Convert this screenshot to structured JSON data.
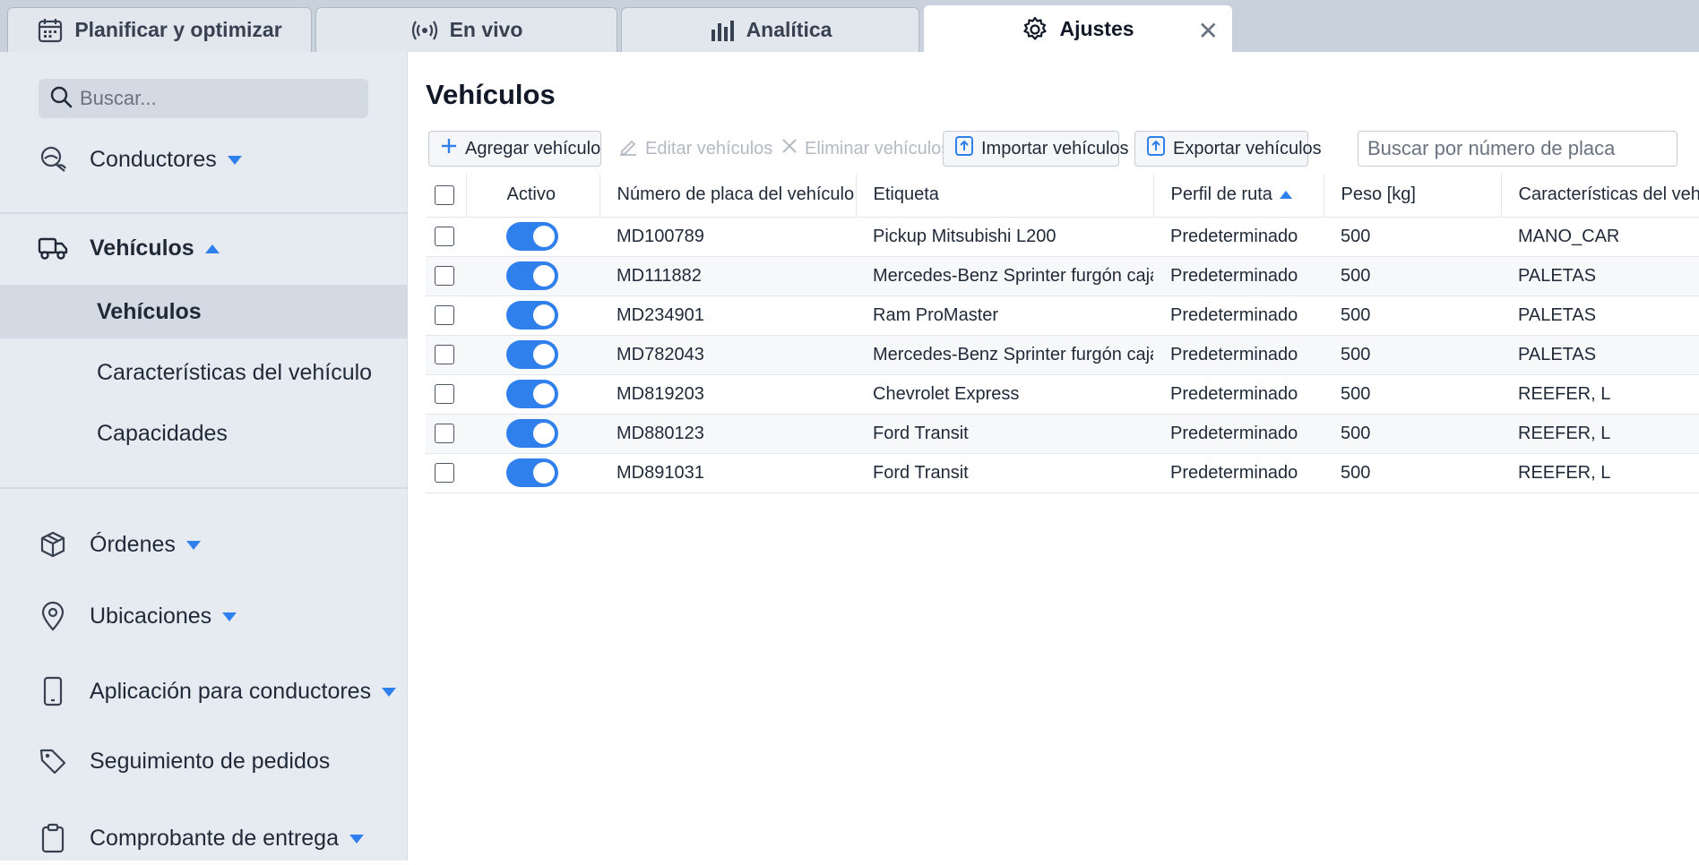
{
  "tabs": [
    {
      "label": "Planificar y optimizar",
      "icon": "calendar-icon"
    },
    {
      "label": "En vivo",
      "icon": "broadcast-icon"
    },
    {
      "label": "Analítica",
      "icon": "bar-chart-icon"
    },
    {
      "label": "Ajustes",
      "icon": "gear-icon",
      "active": true
    }
  ],
  "sidebar": {
    "search_placeholder": "Buscar...",
    "items": [
      {
        "label": "Conductores",
        "icon": "drivers-icon",
        "expanded": false
      },
      {
        "label": "Vehículos",
        "icon": "truck-icon",
        "expanded": true
      },
      {
        "label": "Órdenes",
        "icon": "box-icon",
        "expanded": false
      },
      {
        "label": "Ubicaciones",
        "icon": "location-pin-icon",
        "expanded": false
      },
      {
        "label": "Aplicación para conductores",
        "icon": "mobile-icon",
        "expanded": false
      },
      {
        "label": "Seguimiento de pedidos",
        "icon": "tag-icon",
        "expanded": null
      },
      {
        "label": "Comprobante de entrega",
        "icon": "clipboard-icon",
        "expanded": false
      }
    ],
    "subitems": [
      {
        "label": "Vehículos",
        "active": true
      },
      {
        "label": "Características del vehículo"
      },
      {
        "label": "Capacidades"
      }
    ]
  },
  "main": {
    "title": "Vehículos",
    "toolbar": {
      "add": "Agregar vehículo",
      "edit": "Editar vehículos",
      "delete": "Eliminar vehículos",
      "import": "Importar vehículos",
      "export": "Exportar vehículos",
      "search_placeholder": "Buscar por número de placa"
    },
    "columns": [
      "Activo",
      "Número de placa del vehículo",
      "Etiqueta",
      "Perfil de ruta",
      "Peso [kg]",
      "Características del vehículo"
    ],
    "rows": [
      {
        "active": true,
        "plate": "MD100789",
        "label": "Pickup Mitsubishi L200",
        "profile": "Predeterminado",
        "weight": "500",
        "features": "MANO_CAR"
      },
      {
        "active": true,
        "plate": "MD111882",
        "label": "Mercedes-Benz Sprinter furgón caja",
        "profile": "Predeterminado",
        "weight": "500",
        "features": "PALETAS"
      },
      {
        "active": true,
        "plate": "MD234901",
        "label": "Ram ProMaster",
        "profile": "Predeterminado",
        "weight": "500",
        "features": "PALETAS"
      },
      {
        "active": true,
        "plate": "MD782043",
        "label": "Mercedes-Benz Sprinter furgón caja",
        "profile": "Predeterminado",
        "weight": "500",
        "features": "PALETAS"
      },
      {
        "active": true,
        "plate": "MD819203",
        "label": "Chevrolet Express",
        "profile": "Predeterminado",
        "weight": "500",
        "features": "REEFER, L"
      },
      {
        "active": true,
        "plate": "MD880123",
        "label": "Ford Transit",
        "profile": "Predeterminado",
        "weight": "500",
        "features": "REEFER, L"
      },
      {
        "active": true,
        "plate": "MD891031",
        "label": "Ford Transit",
        "profile": "Predeterminado",
        "weight": "500",
        "features": "REEFER, L"
      }
    ]
  },
  "colors": {
    "accent": "#2f80ed",
    "sidebar_bg": "#e6ebf1",
    "tabbar_bg": "#c9d2dc"
  }
}
